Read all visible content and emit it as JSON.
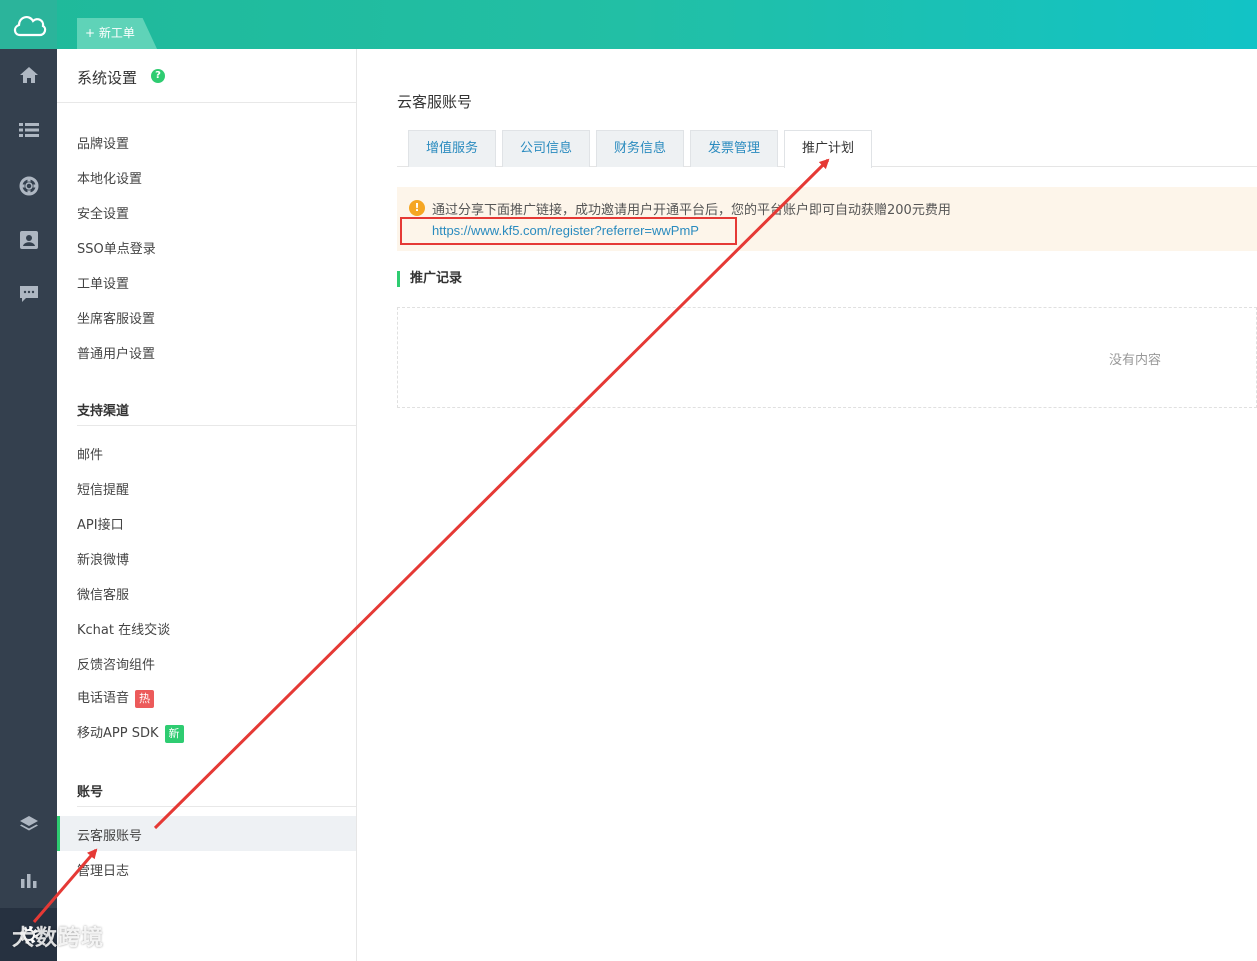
{
  "topbar": {
    "new_ticket_label": "+ 新工单",
    "colors": {
      "gradient_start": "#1fb99a",
      "gradient_end": "#12c3c6"
    }
  },
  "rail": {
    "icons": [
      "home-icon",
      "list-icon",
      "support-icon",
      "contact-icon",
      "chat-icon",
      "layers-icon",
      "chart-icon",
      "settings-icon"
    ]
  },
  "subnav": {
    "title": "系统设置",
    "general_items": [
      "品牌设置",
      "本地化设置",
      "安全设置",
      "SSO单点登录",
      "工单设置",
      "坐席客服设置",
      "普通用户设置"
    ],
    "channels_section": "支持渠道",
    "channel_items": [
      "邮件",
      "短信提醒",
      "API接口",
      "新浪微博",
      "微信客服",
      "Kchat 在线交谈",
      "反馈咨询组件",
      "电话语音",
      "移动APP SDK"
    ],
    "badge_hot": "热",
    "badge_new": "新",
    "account_section": "账号",
    "account_items": [
      "云客服账号",
      "管理日志"
    ]
  },
  "main": {
    "page_title": "云客服账号",
    "tabs": [
      "增值服务",
      "公司信息",
      "财务信息",
      "发票管理",
      "推广计划"
    ],
    "active_tab": "推广计划",
    "notice_text": "通过分享下面推广链接，成功邀请用户开通平台后，您的平台账户即可自动获赠200元费用",
    "referral_link": "https://www.kf5.com/register?referrer=wwPmP",
    "records_title": "推广记录",
    "empty_text": "没有内容"
  },
  "watermark": "大数跨境",
  "accent_colors": {
    "green": "#2ecc71",
    "link": "#2a8bbf",
    "annotation_red": "#e53935"
  }
}
